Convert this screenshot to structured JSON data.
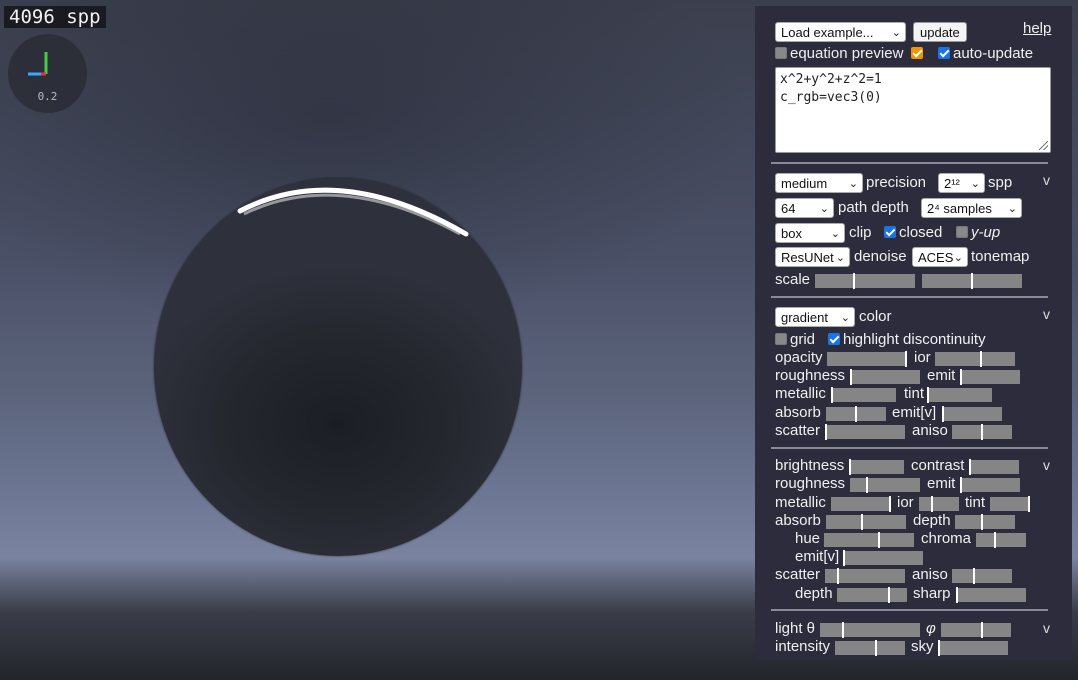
{
  "viewport": {
    "spp_counter": "4096 spp",
    "axis_scale": "0.2",
    "axis_colors": {
      "x": "#e33",
      "y": "#4c4",
      "z": "#3af"
    }
  },
  "panel": {
    "example_select": "Load example...",
    "update_button": "update",
    "help_link": "help",
    "equation_preview_label": "equation preview",
    "equation_preview_checked": false,
    "orange_checked": true,
    "auto_update_label": "auto-update",
    "auto_update_checked": true,
    "equation_lines": [
      "x^2+y^2+z^2=1",
      "c_rgb=vec3(0)"
    ],
    "render": {
      "precision_select": "medium",
      "precision_label": "precision",
      "spp_select": "2¹²",
      "spp_label": "spp",
      "depth_select": "64",
      "path_depth_label": "path depth",
      "samples_select": "2⁴ samples",
      "clip_select": "box",
      "clip_label": "clip",
      "closed_label": "closed",
      "closed_checked": true,
      "yup_label": "y-up",
      "yup_checked": false,
      "denoise_select": "ResUNet",
      "denoise_label": "denoise",
      "tonemap_select": "ACES",
      "tonemap_label": "tonemap",
      "scale_label": "scale",
      "caret": "v"
    },
    "color": {
      "color_select": "gradient",
      "color_label": "color",
      "grid_label": "grid",
      "grid_checked": false,
      "highlight_label": "highlight discontinuity",
      "highlight_checked": true,
      "opacity": "opacity",
      "ior": "ior",
      "roughness": "roughness",
      "emit": "emit",
      "metallic": "metallic",
      "tint": "tint",
      "absorb": "absorb",
      "emitv": "emit[v]",
      "scatter": "scatter",
      "aniso": "aniso",
      "caret": "v"
    },
    "material": {
      "brightness": "brightness",
      "contrast": "contrast",
      "roughness": "roughness",
      "emit": "emit",
      "metallic": "metallic",
      "ior": "ior",
      "tint": "tint",
      "absorb": "absorb",
      "depth": "depth",
      "hue": "hue",
      "chroma": "chroma",
      "emitv": "emit[v]",
      "scatter": "scatter",
      "aniso": "aniso",
      "depth2": "depth",
      "sharp": "sharp",
      "caret": "v"
    },
    "light": {
      "theta": "light θ",
      "phi": "φ",
      "intensity": "intensity",
      "sky": "sky",
      "caret": "v"
    }
  }
}
